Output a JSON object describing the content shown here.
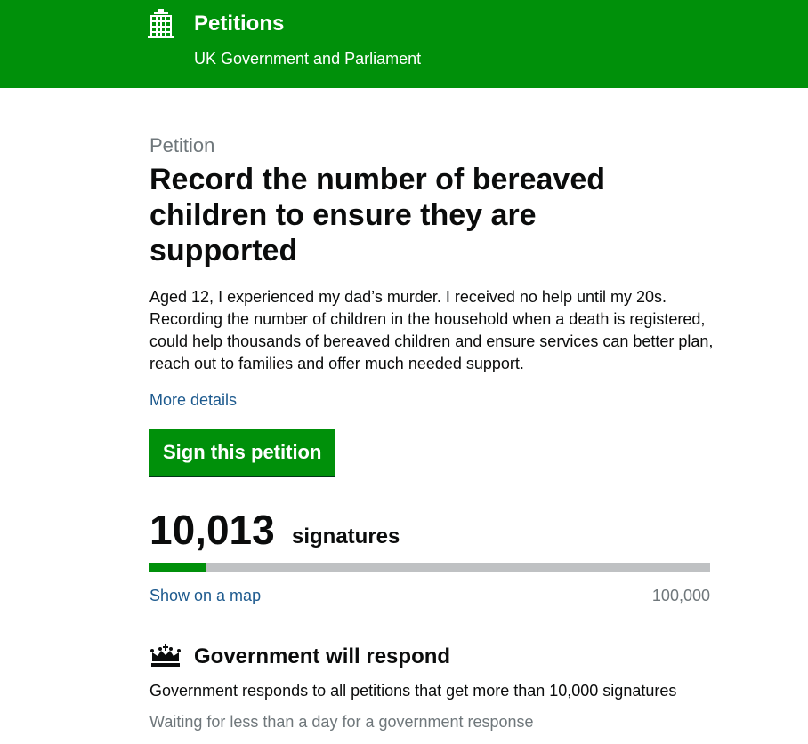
{
  "header": {
    "logo_icon": "portcullis-icon",
    "title": "Petitions",
    "subtitle": "UK Government and Parliament",
    "background_color": "#00900a"
  },
  "petition": {
    "kicker": "Petition",
    "title": "Record the number of bereaved children to ensure they are supported",
    "summary": "Aged 12, I experienced my dad’s murder. I received no help until my 20s. Recording the number of children in the household when a death is registered, could help thousands of bereaved children and ensure services can better plan, reach out to families and offer much needed support.",
    "more_details_label": "More details",
    "sign_button_label": "Sign this petition"
  },
  "signatures": {
    "count": "10,013",
    "label": "signatures",
    "progress_fraction": 0.1,
    "map_link_label": "Show on a map",
    "threshold": "100,000"
  },
  "response": {
    "icon": "crown-icon",
    "title": "Government will respond",
    "text": "Government responds to all petitions that get more than 10,000 signatures",
    "status": "Waiting for less than a day for a government response"
  },
  "colors": {
    "brand_green": "#00900a",
    "link_blue": "#1d5a8e",
    "secondary_text": "#6f777b",
    "progress_track": "#bfc1c3"
  }
}
